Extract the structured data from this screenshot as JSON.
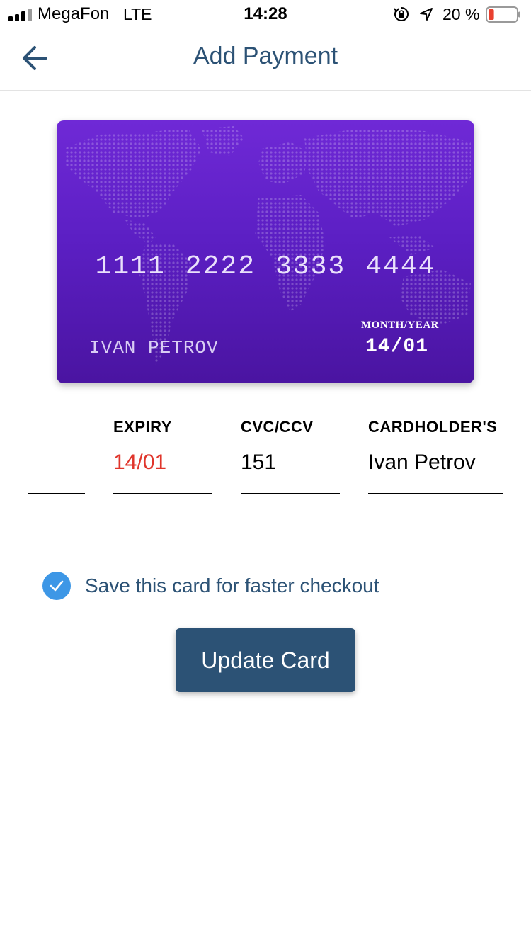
{
  "status_bar": {
    "carrier": "MegaFon",
    "network": "LTE",
    "time": "14:28",
    "battery_percent": "20 %",
    "battery_level": 0.2,
    "battery_color": "#e9402f"
  },
  "header": {
    "title": "Add Payment",
    "back_icon": "arrow-left-icon"
  },
  "card": {
    "number_groups": [
      "1111",
      "2222",
      "3333",
      "4444"
    ],
    "holder": "IVAN PETROV",
    "expiry_label": "MONTH/YEAR",
    "expiry": "14/01",
    "gradient_top": "#6f29d6",
    "gradient_bottom": "#4a14a1"
  },
  "form": {
    "expiry": {
      "label": "EXPIRY",
      "value": "14/01",
      "value_color": "#e0352b"
    },
    "cvc": {
      "label": "CVC/CCV",
      "value": "151"
    },
    "cardholder": {
      "label": "CARDHOLDER'S",
      "value": "Ivan Petrov"
    },
    "card_number": {
      "value": ""
    }
  },
  "save_option": {
    "label": "Save this card for faster checkout",
    "checked": true,
    "icon": "checkmark-icon",
    "color": "#3d97e6"
  },
  "actions": {
    "update_label": "Update Card",
    "button_color": "#2c5275"
  },
  "colors": {
    "accent": "#2c5275",
    "error": "#e0352b"
  }
}
